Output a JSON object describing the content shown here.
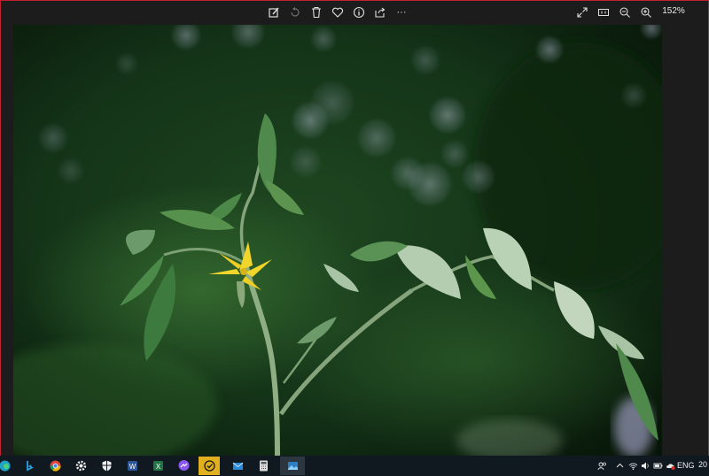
{
  "toolbar": {
    "icons": [
      "edit-image-icon",
      "rotate-icon",
      "delete-icon",
      "favorite-icon",
      "info-icon",
      "share-icon",
      "more-icon"
    ],
    "more_label": "···",
    "right_icons": [
      "fullscreen-icon",
      "actual-size-icon",
      "zoom-out-icon",
      "zoom-in-icon"
    ],
    "zoom_level": "152%"
  },
  "photo": {
    "subject": "yellow tomato flower on green stem",
    "colors": {
      "background_dark": "#0a1a0c",
      "background_mid": "#1f4a22",
      "stem": "#8fae84",
      "leaf": "#6d9a6a",
      "leaf_light": "#a9c4a4",
      "flower": "#f2d52a",
      "bokeh": "#9aa7c4"
    }
  },
  "taskbar": {
    "apps": [
      "edge-icon",
      "bing-icon",
      "chrome-icon",
      "settings-icon",
      "security-icon",
      "word-icon",
      "excel-icon",
      "messenger-icon",
      "sticky-notes-icon",
      "mail-icon",
      "calculator-icon",
      "photos-icon"
    ],
    "active_app": "sticky-notes-icon",
    "open_app": "photos-icon",
    "tray": {
      "icons": [
        "people-icon",
        "chevron-up-icon",
        "network-icon",
        "volume-icon",
        "battery-icon",
        "onedrive-icon"
      ],
      "language": "ENG",
      "clock": "20"
    }
  }
}
